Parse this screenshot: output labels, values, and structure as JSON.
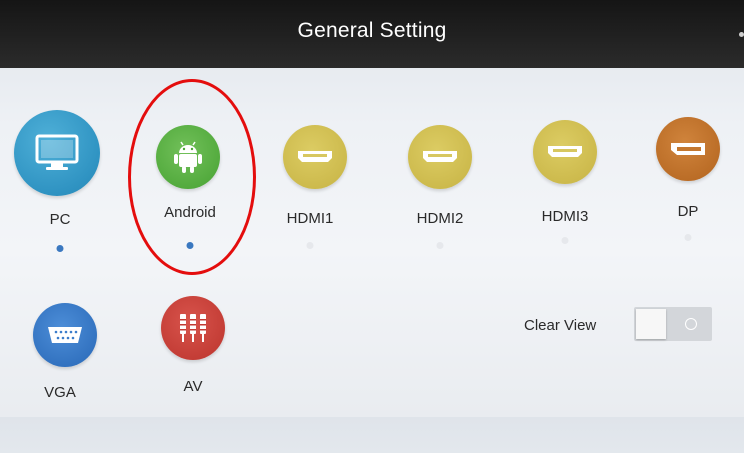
{
  "header": {
    "title": "General Setting"
  },
  "sources": [
    {
      "label": "PC",
      "icon": "monitor-icon",
      "color": "#2f93c2",
      "indicator_color": "#3a78c0",
      "active": true
    },
    {
      "label": "Android",
      "icon": "android-icon",
      "color": "#4fa83a",
      "indicator_color": "#3a78c0",
      "active": true
    },
    {
      "label": "HDMI1",
      "icon": "hdmi-port-icon",
      "color": "#cbb84a",
      "indicator_color": "#e6e8ec",
      "active": false
    },
    {
      "label": "HDMI2",
      "icon": "hdmi-port-icon",
      "color": "#cbb84a",
      "indicator_color": "#e6e8ec",
      "active": false
    },
    {
      "label": "HDMI3",
      "icon": "hdmi-port-icon",
      "color": "#cbb84a",
      "indicator_color": "#e6e8ec",
      "active": false
    },
    {
      "label": "DP",
      "icon": "displayport-icon",
      "color": "#b86a24",
      "indicator_color": "#e6e8ec",
      "active": false
    },
    {
      "label": "VGA",
      "icon": "vga-port-icon",
      "color": "#2f6fbd",
      "active": false
    },
    {
      "label": "AV",
      "icon": "av-jack-icon",
      "color": "#c13a33",
      "active": false
    }
  ],
  "clear_view": {
    "label": "Clear View",
    "state": "off"
  },
  "annotation": {
    "color": "#e40d0d",
    "target": "Android"
  }
}
